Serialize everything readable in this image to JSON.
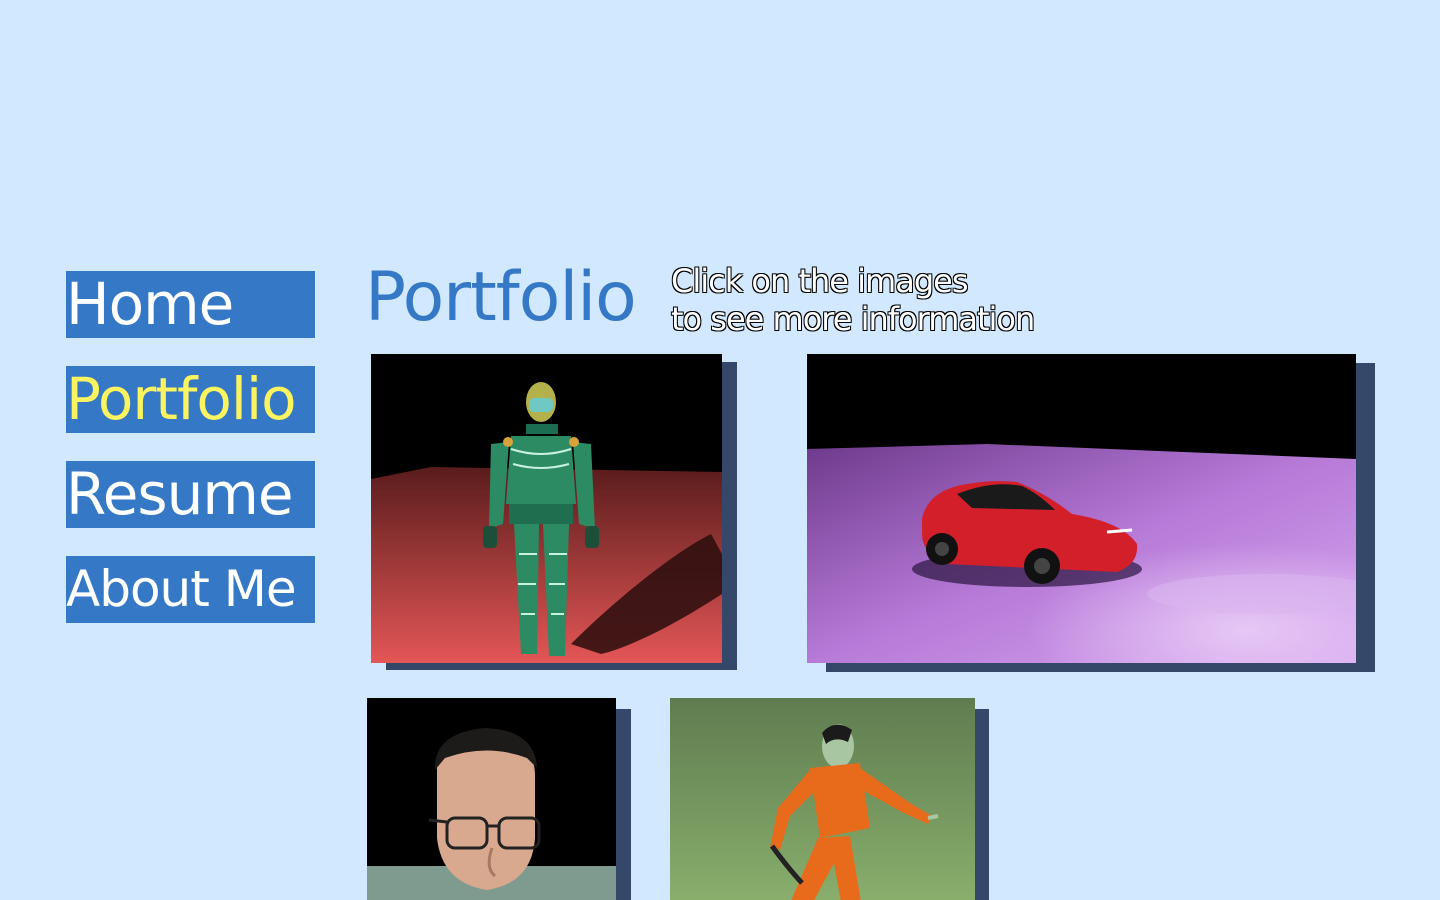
{
  "nav": {
    "items": [
      {
        "label": "Home",
        "active": false
      },
      {
        "label": "Portfolio",
        "active": true
      },
      {
        "label": "Resume",
        "active": false
      },
      {
        "label": "About Me",
        "active": false
      }
    ],
    "colors": {
      "background": "#3478c6",
      "text": "#ffffff",
      "active_text": "#fbf35f"
    }
  },
  "main": {
    "title": "Portfolio",
    "hint_line1": "Click on the images",
    "hint_line2": "to see more information"
  },
  "gallery": {
    "items": [
      {
        "subject": "robot-character-render"
      },
      {
        "subject": "red-car-render"
      },
      {
        "subject": "head-with-glasses-render"
      },
      {
        "subject": "orange-jumpsuit-character-render"
      }
    ]
  },
  "colors": {
    "page_background": "#d1e8ff",
    "accent": "#3478c6",
    "shadow": "#35486a"
  }
}
